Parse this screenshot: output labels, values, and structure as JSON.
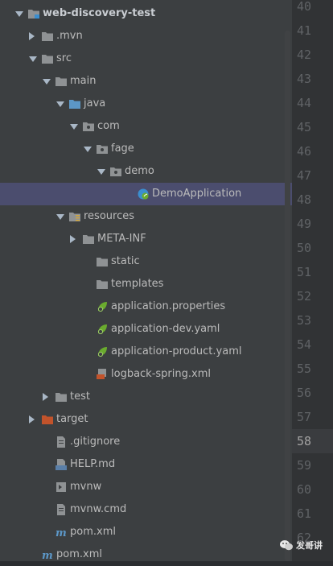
{
  "tree": [
    {
      "label": "web-discovery-test",
      "indent": 0,
      "arrow": "down",
      "icon": "module-folder-icon",
      "bold": true
    },
    {
      "label": ".mvn",
      "indent": 1,
      "arrow": "right",
      "icon": "folder-icon"
    },
    {
      "label": "src",
      "indent": 1,
      "arrow": "down",
      "icon": "folder-icon"
    },
    {
      "label": "main",
      "indent": 2,
      "arrow": "down",
      "icon": "folder-icon"
    },
    {
      "label": "java",
      "indent": 3,
      "arrow": "down",
      "icon": "source-folder-icon"
    },
    {
      "label": "com",
      "indent": 4,
      "arrow": "down",
      "icon": "package-icon"
    },
    {
      "label": "fage",
      "indent": 5,
      "arrow": "down",
      "icon": "package-icon"
    },
    {
      "label": "demo",
      "indent": 6,
      "arrow": "down",
      "icon": "package-icon"
    },
    {
      "label": "DemoApplication",
      "indent": 8,
      "arrow": "none",
      "icon": "spring-boot-class-icon",
      "selected": true
    },
    {
      "label": "resources",
      "indent": 3,
      "arrow": "down",
      "icon": "resources-folder-icon"
    },
    {
      "label": "META-INF",
      "indent": 4,
      "arrow": "right",
      "icon": "folder-icon"
    },
    {
      "label": "static",
      "indent": 5,
      "arrow": "none",
      "icon": "folder-icon"
    },
    {
      "label": "templates",
      "indent": 5,
      "arrow": "none",
      "icon": "folder-icon"
    },
    {
      "label": "application.properties",
      "indent": 5,
      "arrow": "none",
      "icon": "spring-config-icon"
    },
    {
      "label": "application-dev.yaml",
      "indent": 5,
      "arrow": "none",
      "icon": "spring-config-icon"
    },
    {
      "label": "application-product.yaml",
      "indent": 5,
      "arrow": "none",
      "icon": "spring-config-icon"
    },
    {
      "label": "logback-spring.xml",
      "indent": 5,
      "arrow": "none",
      "icon": "xml-file-icon"
    },
    {
      "label": "test",
      "indent": 2,
      "arrow": "right",
      "icon": "folder-icon"
    },
    {
      "label": "target",
      "indent": 1,
      "arrow": "right",
      "icon": "excluded-folder-icon"
    },
    {
      "label": ".gitignore",
      "indent": 2,
      "arrow": "none",
      "icon": "text-file-icon"
    },
    {
      "label": "HELP.md",
      "indent": 2,
      "arrow": "none",
      "icon": "markdown-file-icon"
    },
    {
      "label": "mvnw",
      "indent": 2,
      "arrow": "none",
      "icon": "script-file-icon"
    },
    {
      "label": "mvnw.cmd",
      "indent": 2,
      "arrow": "none",
      "icon": "text-file-icon"
    },
    {
      "label": "pom.xml",
      "indent": 2,
      "arrow": "none",
      "icon": "maven-file-icon"
    },
    {
      "label": "pom.xml",
      "indent": 1,
      "arrow": "none",
      "icon": "maven-file-icon"
    }
  ],
  "line_numbers": [
    "40",
    "41",
    "42",
    "43",
    "44",
    "45",
    "46",
    "47",
    "48",
    "49",
    "50",
    "51",
    "52",
    "53",
    "54",
    "55",
    "56",
    "57",
    "58",
    "59",
    "60",
    "61",
    "62"
  ],
  "current_line": "58",
  "watermark": {
    "text": "发哥讲"
  },
  "colors": {
    "selection": "#4b4d6e",
    "folder": "#8f9294",
    "package_folder": "#879099",
    "spring": "#6aab2e",
    "excluded": "#c2532b"
  }
}
